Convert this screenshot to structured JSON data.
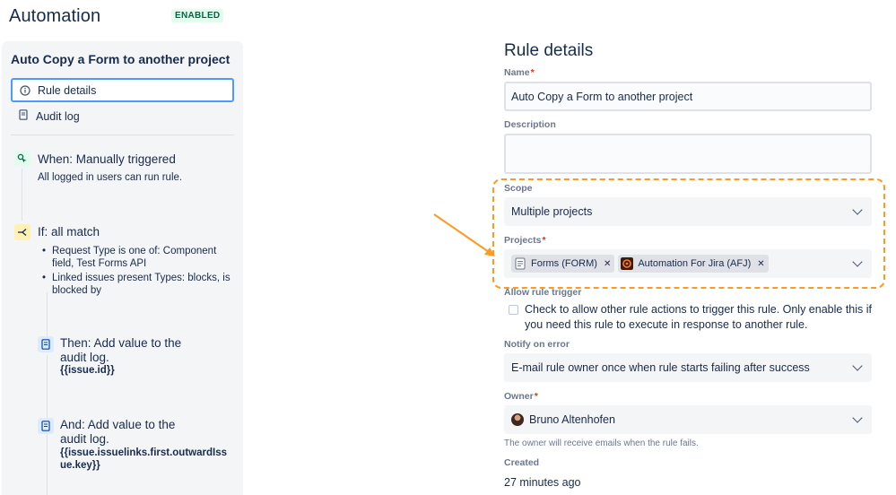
{
  "header": {
    "title": "Automation",
    "status": "ENABLED"
  },
  "sidebar": {
    "rule_name": "Auto Copy a Form to another project",
    "nav": [
      {
        "label": "Rule details",
        "icon": "info-icon",
        "selected": true
      },
      {
        "label": "Audit log",
        "icon": "document-icon",
        "selected": false
      }
    ],
    "components": {
      "trigger": {
        "title": "When: Manually triggered",
        "desc": "All logged in users can run rule.",
        "icon": "manual-trigger-icon"
      },
      "condition": {
        "title": "If: all match",
        "icon": "branch-icon",
        "bullets": [
          "Request Type is one of: Component field, Test Forms API",
          "Linked issues present Types: blocks, is blocked by"
        ]
      },
      "action1": {
        "title": "Then: Add value to the audit log.",
        "value": "{{issue.id}}",
        "icon": "audit-log-icon"
      },
      "action2": {
        "title": "And: Add value to the audit log.",
        "value": "{{issue.issuelinks.first.outwardIssue.key}}",
        "icon": "audit-log-icon"
      }
    }
  },
  "main": {
    "title": "Rule details",
    "name_label": "Name",
    "name_value": "Auto Copy a Form to another project",
    "description_label": "Description",
    "description_value": "",
    "scope_label": "Scope",
    "scope_value": "Multiple projects",
    "projects_label": "Projects",
    "projects": [
      {
        "label": "Forms (FORM)",
        "icon": "forms-project-icon"
      },
      {
        "label": "Automation For Jira (AFJ)",
        "icon": "afj-project-icon"
      }
    ],
    "allow_trigger_label": "Allow rule trigger",
    "allow_trigger_text": "Check to allow other rule actions to trigger this rule. Only enable this if you need this rule to execute in response to another rule.",
    "notify_label": "Notify on error",
    "notify_value": "E-mail rule owner once when rule starts failing after success",
    "owner_label": "Owner",
    "owner_value": "Bruno Altenhofen",
    "owner_help": "The owner will receive emails when the rule fails.",
    "created_label": "Created",
    "created_value": "27 minutes ago"
  },
  "colors": {
    "accent": "#4c9aff",
    "highlight": "#ff991f",
    "enabled_bg": "#e3fcef",
    "enabled_text": "#006644",
    "required": "#de350b"
  }
}
